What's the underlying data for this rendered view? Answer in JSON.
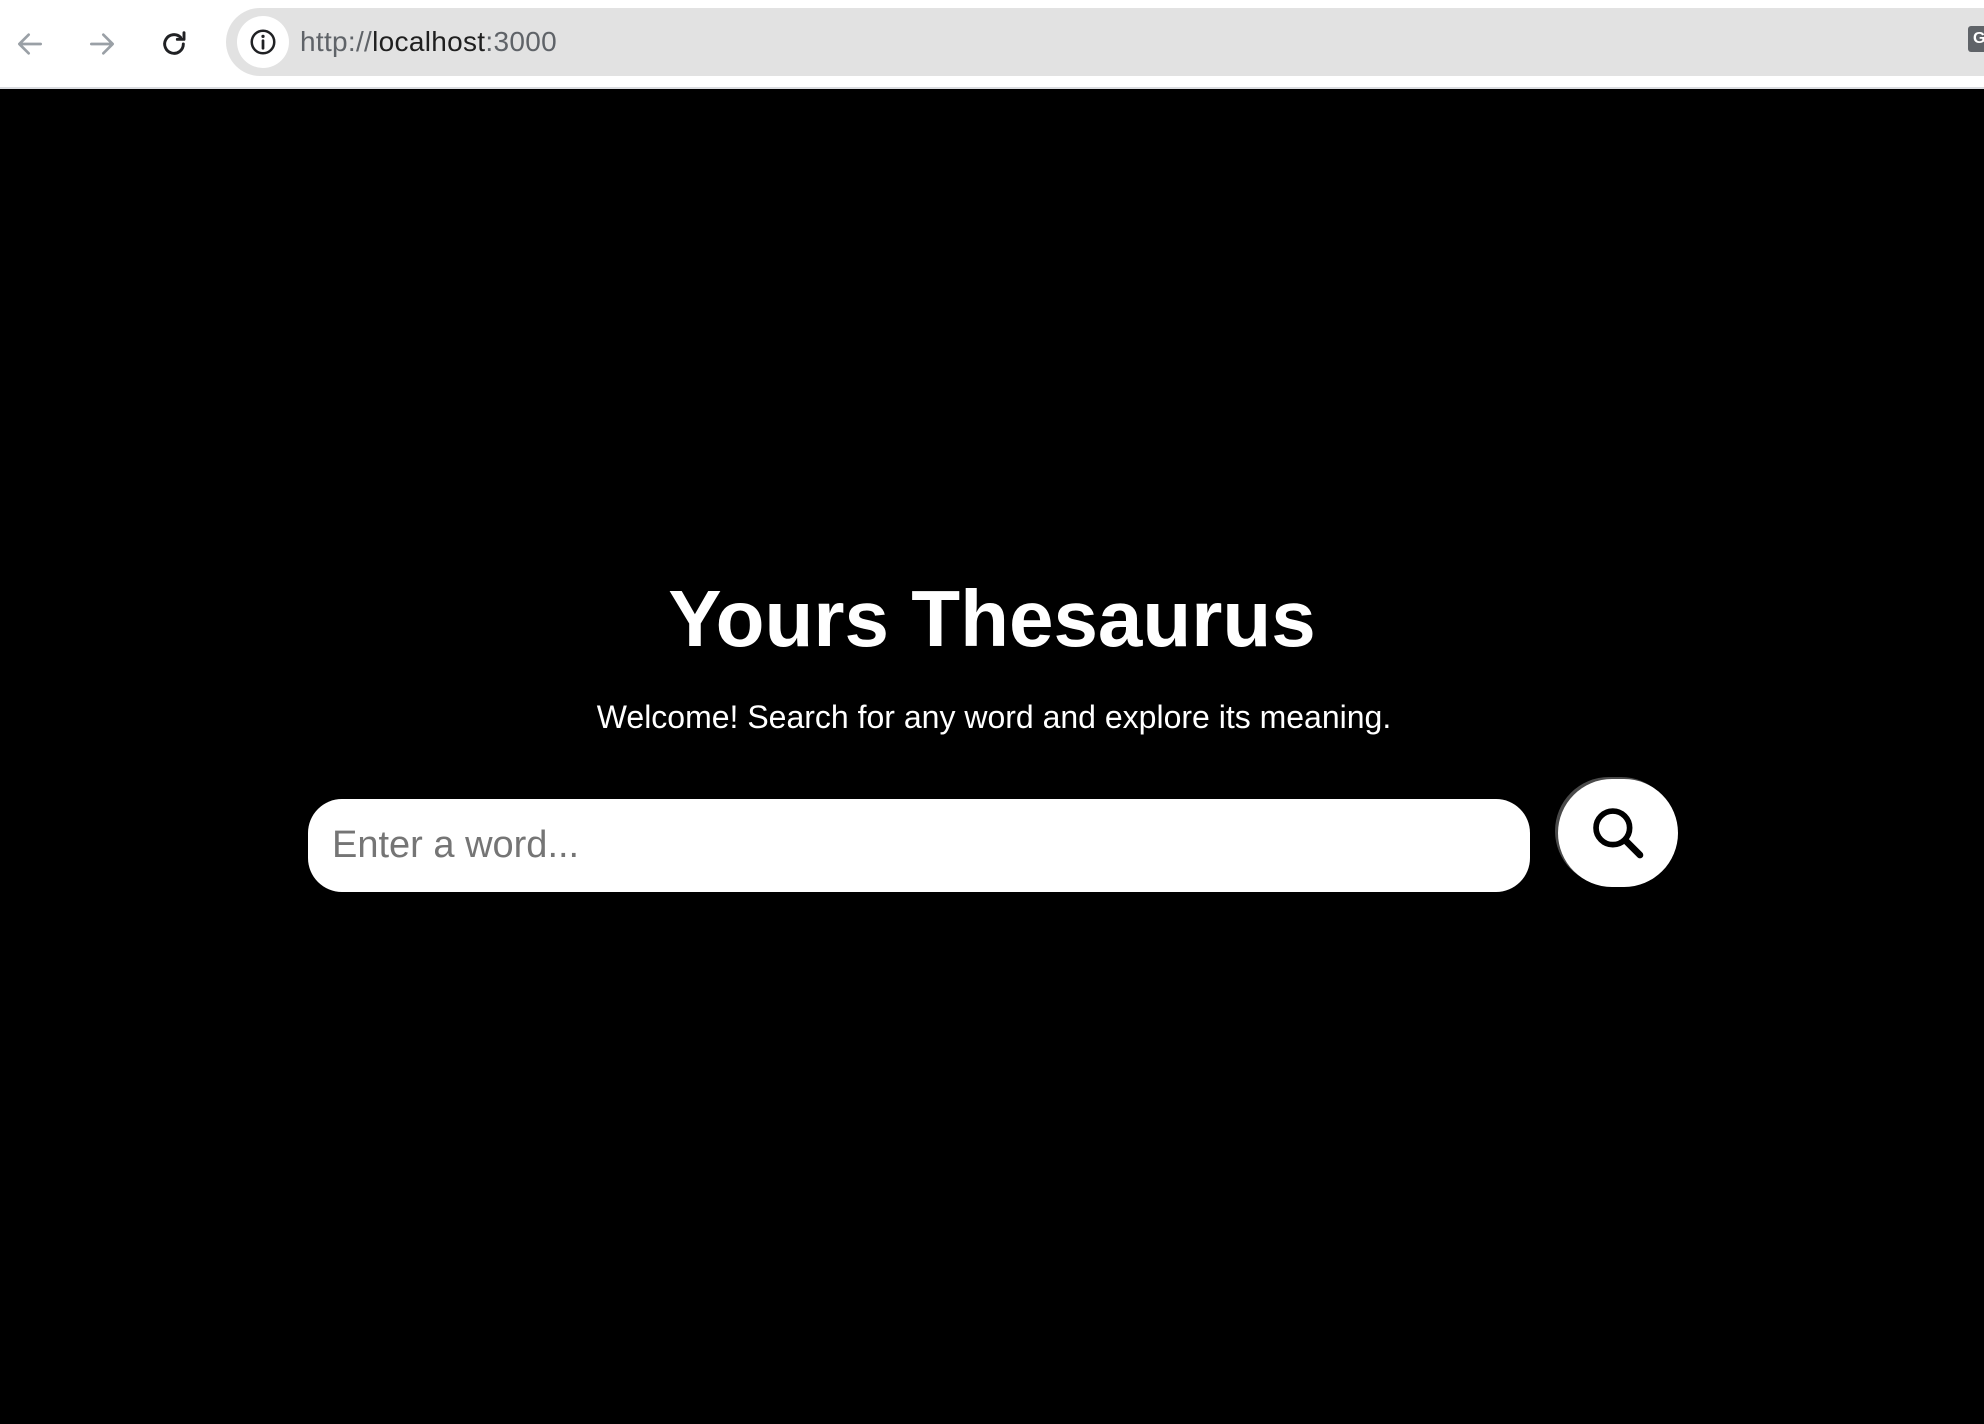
{
  "browser": {
    "url_scheme": "http://",
    "url_host": "localhost",
    "url_port": ":3000",
    "extension_label": "G",
    "icons": {
      "back": "arrow-left-icon",
      "forward": "arrow-right-icon",
      "reload": "reload-icon",
      "site_info": "info-icon"
    }
  },
  "page": {
    "background": "#000000",
    "text_color": "#ffffff",
    "title": "Yours Thesaurus",
    "subtitle": "Welcome! Search for any word and explore its meaning.",
    "search": {
      "placeholder": "Enter a word...",
      "value": "",
      "button_icon": "search-icon"
    }
  }
}
